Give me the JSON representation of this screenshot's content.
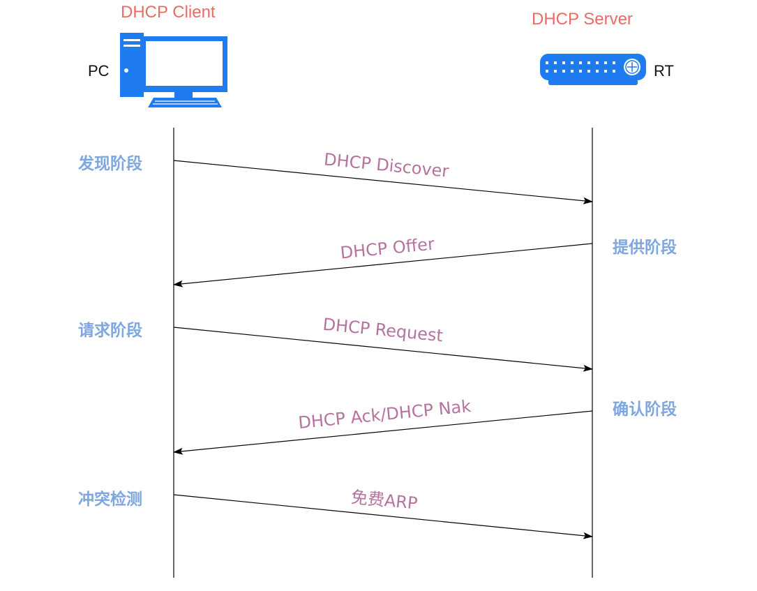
{
  "client": {
    "role": "DHCP Client",
    "label": "PC",
    "icon": "pc-icon"
  },
  "server": {
    "role": "DHCP Server",
    "label": "RT",
    "icon": "router-icon"
  },
  "phases": {
    "discover": "发现阶段",
    "offer": "提供阶段",
    "request": "请求阶段",
    "ack": "确认阶段",
    "conflict": "冲突检测"
  },
  "messages": [
    {
      "label": "DHCP Discover",
      "from": "client",
      "to": "server"
    },
    {
      "label": "DHCP Offer",
      "from": "server",
      "to": "client"
    },
    {
      "label": "DHCP Request",
      "from": "client",
      "to": "server"
    },
    {
      "label": "DHCP Ack/DHCP Nak",
      "from": "server",
      "to": "client"
    },
    {
      "label": "免费ARP",
      "from": "client",
      "to": "server"
    }
  ],
  "colors": {
    "role_title": "#ea6b66",
    "phase_label": "#7ea6e0",
    "message_label": "#b5739d",
    "device_blue": "#1e7bf0",
    "line": "#000000"
  }
}
